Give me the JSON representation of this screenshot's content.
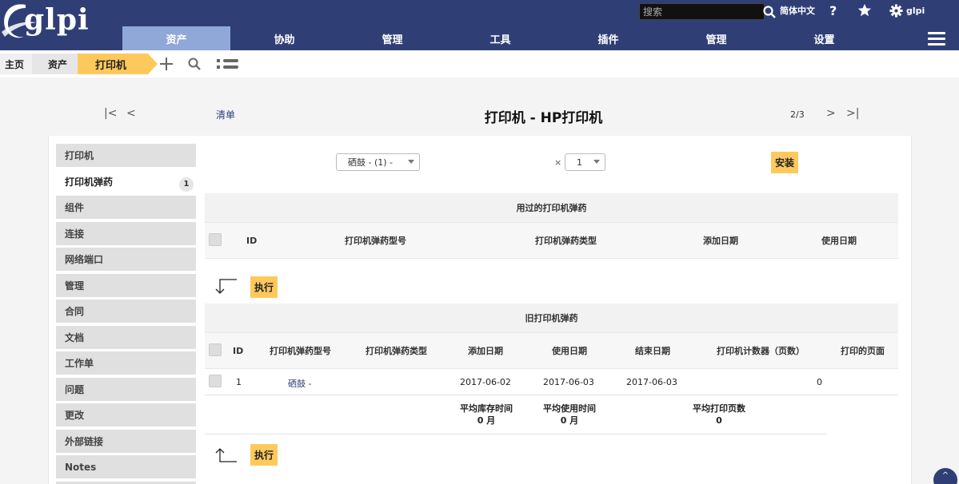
{
  "app": {
    "logo": "glpi"
  },
  "search": {
    "placeholder": "搜索"
  },
  "top": {
    "language": "简体中文",
    "help": "?",
    "user": "glpi"
  },
  "menu": [
    "资产",
    "协助",
    "管理",
    "工具",
    "插件",
    "管理",
    "设置"
  ],
  "breadcrumb": {
    "home": "主页",
    "assets": "资产",
    "current": "打印机"
  },
  "nav": {
    "list_label": "清单",
    "title": "打印机 - HP打印机",
    "page": "2/3"
  },
  "tabs": [
    {
      "label": "打印机"
    },
    {
      "label": "打印机弹药",
      "badge": "1"
    },
    {
      "label": "组件"
    },
    {
      "label": "连接"
    },
    {
      "label": "网络端口"
    },
    {
      "label": "管理"
    },
    {
      "label": "合同"
    },
    {
      "label": "文档"
    },
    {
      "label": "工作单"
    },
    {
      "label": "问题"
    },
    {
      "label": "更改"
    },
    {
      "label": "外部链接"
    },
    {
      "label": "Notes"
    }
  ],
  "install_form": {
    "cartridge_select": "硒鼓 - (1) -",
    "times": "×",
    "quantity": "1",
    "install_button": "安装"
  },
  "used": {
    "title": "用过的打印机弹药",
    "columns": [
      "ID",
      "打印机弹药型号",
      "打印机弹药类型",
      "添加日期",
      "使用日期"
    ],
    "action": "执行"
  },
  "old": {
    "title": "旧打印机弹药",
    "columns": [
      "ID",
      "打印机弹药型号",
      "打印机弹药类型",
      "添加日期",
      "使用日期",
      "结束日期",
      "打印机计数器（页数）",
      "打印的页面"
    ],
    "rows": [
      {
        "id": "1",
        "model": "硒鼓 -",
        "type": "",
        "added": "2017-06-02",
        "used": "2017-06-03",
        "end": "2017-06-03",
        "counter": "0",
        "pages": ""
      }
    ],
    "averages": [
      {
        "label": "平均库存时间",
        "value": "0 月"
      },
      {
        "label": "平均使用时间",
        "value": "0 月"
      },
      {
        "label": "平均打印页数",
        "value": "0"
      }
    ],
    "action": "执行"
  },
  "colors": {
    "header": "#2f3f76",
    "active_menu": "#8fa8d8",
    "accent": "#fec95c"
  }
}
